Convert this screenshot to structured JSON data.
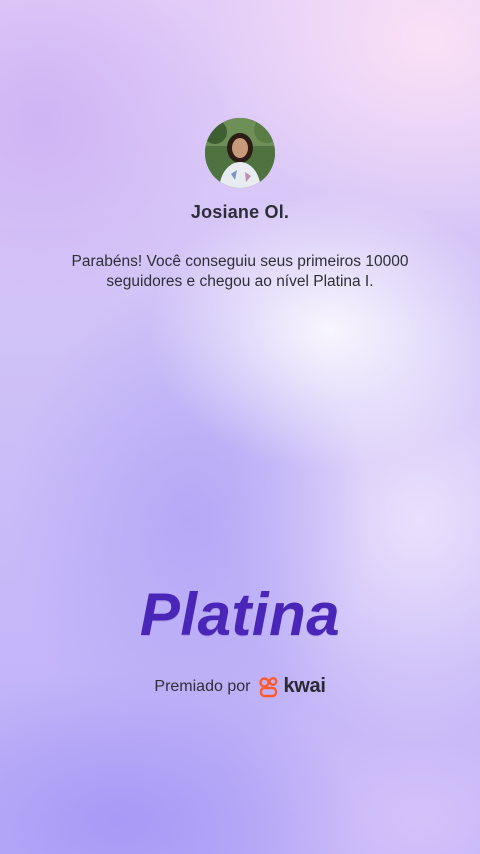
{
  "profile": {
    "name": "Josiane Ol.",
    "avatar_icon": "profile-photo"
  },
  "message": {
    "line1": "Parabéns! Você conseguiu seus primeiros 10000",
    "line2": "seguidores e chegou ao nível Platina I."
  },
  "level": {
    "title": "Platina",
    "color": "#4a26b8"
  },
  "award": {
    "label": "Premiado por",
    "brand_name": "kwai",
    "brand_icon": "kwai-logo-icon",
    "brand_color": "#ff5a2a"
  },
  "colors": {
    "background_top": "#e3cdf8",
    "background_bottom": "#bcaef7",
    "text": "#2f2f36"
  }
}
